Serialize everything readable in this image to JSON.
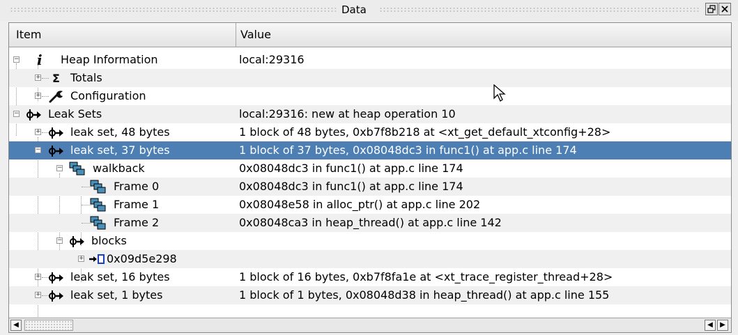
{
  "window": {
    "title": "Data"
  },
  "columns": {
    "item": "Item",
    "value": "Value"
  },
  "rows": [
    {
      "label": "Heap Information",
      "value": "local:29316",
      "icon": "info-icon"
    },
    {
      "label": "Totals",
      "value": "",
      "icon": "sigma-icon"
    },
    {
      "label": "Configuration",
      "value": "",
      "icon": "wrench-icon"
    },
    {
      "label": "Leak Sets",
      "value": "local:29316: new at heap operation 10",
      "icon": "leak-icon"
    },
    {
      "label": "leak set, 48 bytes",
      "value": "1 block of 48 bytes, 0xb7f8b218 at <xt_get_default_xtconfig+28>",
      "icon": "leak-icon"
    },
    {
      "label": "leak set, 37 bytes",
      "value": "1 block of 37 bytes, 0x08048dc3 in func1() at app.c line 174",
      "icon": "leak-icon",
      "selected": true
    },
    {
      "label": "walkback",
      "value": "0x08048dc3 in func1() at app.c line 174",
      "icon": "stack-icon"
    },
    {
      "label": "Frame 0",
      "value": "0x08048dc3 in func1() at app.c line 174",
      "icon": "stack-icon"
    },
    {
      "label": "Frame 1",
      "value": "0x08048e58 in alloc_ptr() at app.c line 202",
      "icon": "stack-icon"
    },
    {
      "label": "Frame 2",
      "value": "0x08048ca3 in heap_thread() at app.c line 142",
      "icon": "stack-icon"
    },
    {
      "label": "blocks",
      "value": "",
      "icon": "leak-icon"
    },
    {
      "label": "0x09d5e298",
      "value": "",
      "icon": "block-icon"
    },
    {
      "label": "leak set, 16 bytes",
      "value": "1 block of 16 bytes, 0xb7f8fa1e at <xt_trace_register_thread+28>",
      "icon": "leak-icon"
    },
    {
      "label": "leak set, 1 bytes",
      "value": "1 block of 1 bytes, 0x08048d38 in heap_thread() at app.c line 155",
      "icon": "leak-icon"
    }
  ],
  "colors": {
    "selection": "#4d7fb5",
    "alt_row": "#f0f0f0",
    "stack_icon": "#4a8fb8"
  }
}
